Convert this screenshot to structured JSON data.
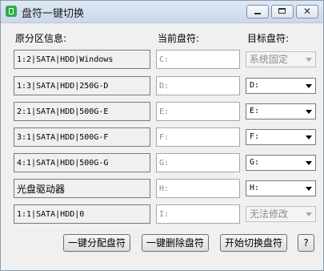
{
  "window": {
    "title": "盘符一键切换",
    "min_label": "",
    "max_label": "",
    "close_label": "✕"
  },
  "headers": {
    "original": "原分区信息:",
    "current": "当前盘符:",
    "target": "目标盘符:"
  },
  "rows": [
    {
      "info": "1:2|SATA|HDD|Windows",
      "current": "C:",
      "target": "系统固定",
      "target_disabled": true
    },
    {
      "info": "1:3|SATA|HDD|250G-D",
      "current": "D:",
      "target": "D:",
      "target_disabled": false
    },
    {
      "info": "2:1|SATA|HDD|500G-E",
      "current": "E:",
      "target": "E:",
      "target_disabled": false
    },
    {
      "info": "3:1|SATA|HDD|500G-F",
      "current": "F:",
      "target": "F:",
      "target_disabled": false
    },
    {
      "info": "4:1|SATA|HDD|500G-G",
      "current": "G:",
      "target": "G:",
      "target_disabled": false
    },
    {
      "info": "光盘驱动器",
      "current": "H:",
      "target": "H:",
      "target_disabled": false
    },
    {
      "info": "1:1|SATA|HDD|0",
      "current": "I:",
      "target": "无法修改",
      "target_disabled": true
    }
  ],
  "buttons": {
    "assign": "一键分配盘符",
    "delete": "一键删除盘符",
    "switch": "开始切换盘符",
    "help": "?"
  },
  "colors": {
    "titlebar": "#cad8ea",
    "app_icon": "#2eaa45"
  }
}
